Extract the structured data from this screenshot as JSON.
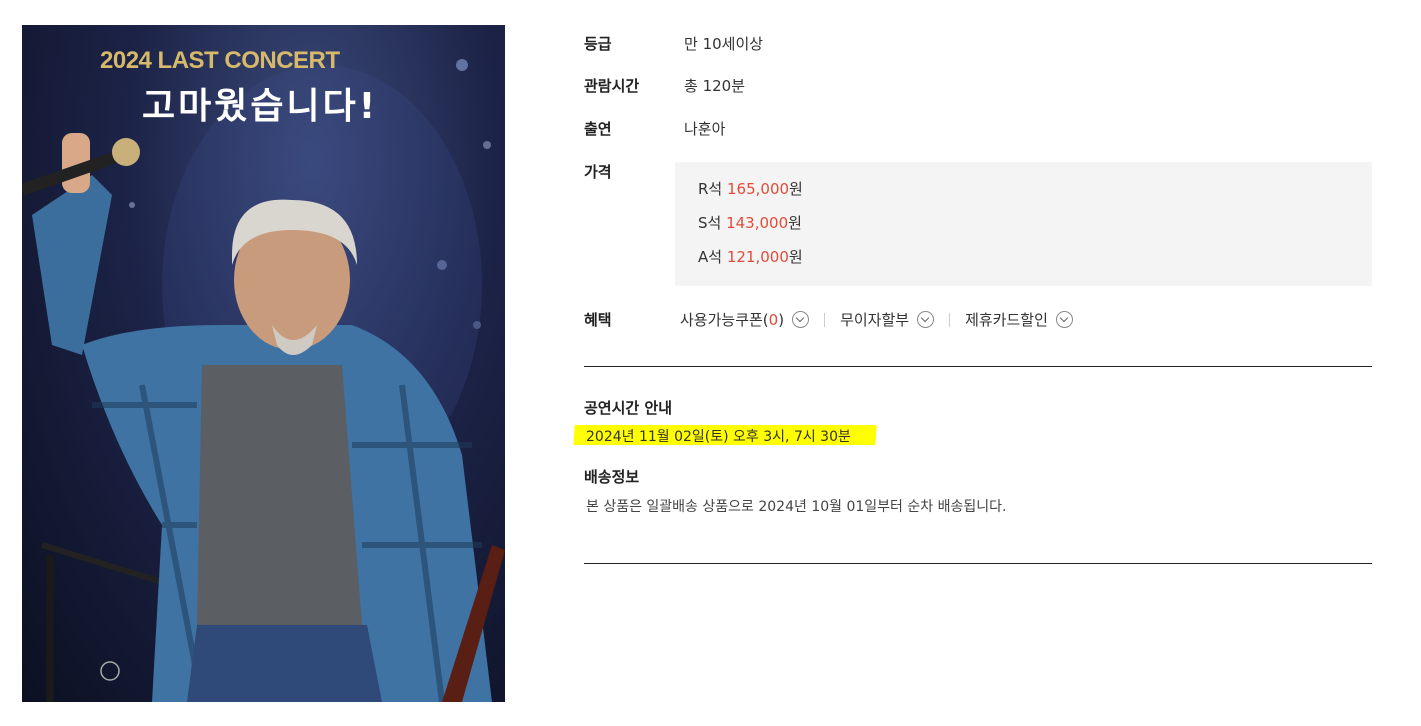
{
  "poster": {
    "title_en": "2024 LAST CONCERT",
    "title_ko": "고마웠습니다!"
  },
  "details": {
    "rating_label": "등급",
    "rating_value": "만 10세이상",
    "runtime_label": "관람시간",
    "runtime_value": "총 120분",
    "cast_label": "출연",
    "cast_value": "나훈아",
    "price_label": "가격",
    "prices": [
      {
        "seat": "R석 ",
        "amount": "165,000",
        "unit": "원"
      },
      {
        "seat": "S석 ",
        "amount": "143,000",
        "unit": "원"
      },
      {
        "seat": "A석 ",
        "amount": "121,000",
        "unit": "원"
      }
    ],
    "benefit_label": "혜택",
    "benefits": {
      "coupon_prefix": "사용가능쿠폰(",
      "coupon_count": "0",
      "coupon_suffix": ")",
      "installment": "무이자할부",
      "card_discount": "제휴카드할인"
    }
  },
  "schedule": {
    "title": "공연시간 안내",
    "text": "2024년 11월 02일(토) 오후 3시, 7시 30분"
  },
  "shipping": {
    "title": "배송정보",
    "text": "본 상품은 일괄배송 상품으로 2024년 10월 01일부터 순차 배송됩니다."
  },
  "colors": {
    "accent_price": "#e04b3a",
    "highlight": "#ffff00"
  }
}
